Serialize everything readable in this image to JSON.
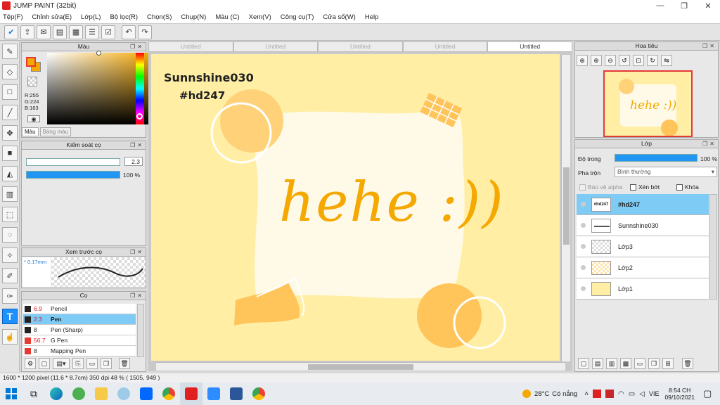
{
  "window": {
    "title": "JUMP PAINT (32bit)",
    "min": "—",
    "max": "❐",
    "close": "✕"
  },
  "menu": [
    "Tệp(F)",
    "Chỉnh sửa(E)",
    "Lớp(L)",
    "Bộ lọc(R)",
    "Chọn(S)",
    "Chụp(N)",
    "Màu (C)",
    "Xem(V)",
    "Công cụ(T)",
    "Cửa sổ(W)",
    "Help"
  ],
  "color_panel": {
    "title": "Màu",
    "rgb": {
      "r": "R:255",
      "g": "G:224",
      "b": "B:163"
    },
    "tabs": [
      "Màu",
      "Bảng màu"
    ],
    "main_color": "#f5a800",
    "secondary_color": "#ffe0a3"
  },
  "brush_control": {
    "title": "Kiểm soát cọ",
    "size": "2.3",
    "opacity": "100 %",
    "opacity_fraction": 1.0
  },
  "brush_preview": {
    "title": "Xem trước cọ",
    "size": "* 0.17mm"
  },
  "brush_list": {
    "title": "Cọ",
    "items": [
      {
        "size": "6.9",
        "name": "Pencil",
        "color": "#222222"
      },
      {
        "size": "2.3",
        "name": "Pen",
        "color": "#222222"
      },
      {
        "size": "8",
        "name": "Pen (Sharp)",
        "color": "#222222"
      },
      {
        "size": "56.7",
        "name": "G Pen",
        "color": "#e53935"
      },
      {
        "size": "8",
        "name": "Mapping Pen",
        "color": "#e53935"
      }
    ]
  },
  "tabs": [
    "Untitled",
    "Untitled",
    "Untitled",
    "Untitled",
    "Untitled"
  ],
  "canvas": {
    "line1": "Sunnshine030",
    "line2": "#hd247",
    "main_text": "hehe :))",
    "bg": "#ffeea4",
    "paper": "#fffae8",
    "accent": "#f5a800",
    "circle": "#ffd27a"
  },
  "navigator": {
    "title": "Hoa tiêu",
    "thumb_text": "hehe :))"
  },
  "layers": {
    "title": "Lớp",
    "opacity_label": "Độ trong",
    "opacity_value": "100 %",
    "blend_label": "Pha trộn",
    "blend_value": "Bình thường",
    "check_alpha": "Bảo vệ alpha",
    "check_clip": "Xén bớt",
    "check_lock": "Khóa",
    "items": [
      {
        "name": "#hd247",
        "thumb": "#hd247"
      },
      {
        "name": "Sunnshine030"
      },
      {
        "name": "Lớp3"
      },
      {
        "name": "Lớp2"
      },
      {
        "name": "Lớp1"
      }
    ]
  },
  "status": {
    "text": "1600 * 1200 pixel   (11.6 * 8.7cm)   350 dpi   48 %   ( 1505, 949 )"
  },
  "taskbar": {
    "weather_temp": "28°C",
    "weather_text": "Có nắng",
    "lang": "VIE",
    "time": "8:54 CH",
    "date": "09/10/2021"
  }
}
